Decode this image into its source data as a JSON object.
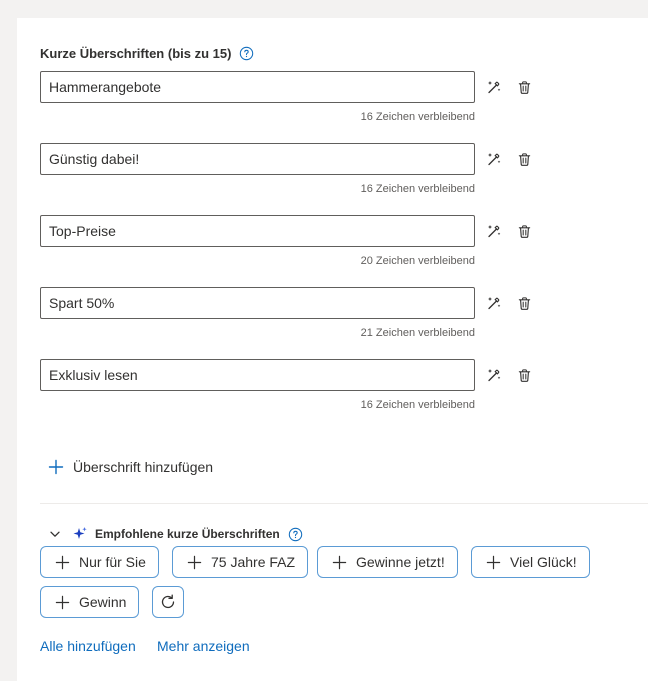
{
  "section": {
    "title": "Kurze Überschriften (bis zu 15)",
    "help_icon": "question-circle-icon"
  },
  "headlines": [
    {
      "value": "Hammerangebote",
      "counter": "16 Zeichen verbleibend"
    },
    {
      "value": "Günstig dabei!",
      "counter": "16 Zeichen verbleibend"
    },
    {
      "value": "Top-Preise",
      "counter": "20 Zeichen verbleibend"
    },
    {
      "value": "Spart 50%",
      "counter": "21 Zeichen verbleibend"
    },
    {
      "value": "Exklusiv lesen",
      "counter": "16 Zeichen verbleibend"
    }
  ],
  "row_icons": {
    "rewrite": "magic-pen-icon",
    "delete": "trash-icon"
  },
  "add_headline": {
    "label": "Überschrift hinzufügen",
    "icon": "plus-icon"
  },
  "recommended": {
    "title": "Empfohlene kurze Überschriften",
    "expanded": true,
    "icons": {
      "toggle": "chevron-down-icon",
      "ai": "sparkle-icon",
      "help": "question-circle-icon",
      "refresh": "refresh-icon"
    },
    "suggestions": [
      "Nur für Sie",
      "75 Jahre FAZ",
      "Gewinne jetzt!",
      "Viel Glück!",
      "Gewinn"
    ]
  },
  "footer": {
    "add_all": "Alle hinzufügen",
    "show_more": "Mehr anzeigen"
  },
  "colors": {
    "link": "#0f6cbd",
    "pill_border": "#5b9bd5",
    "accent": "#0f6cbd",
    "border": "#605e5c"
  }
}
